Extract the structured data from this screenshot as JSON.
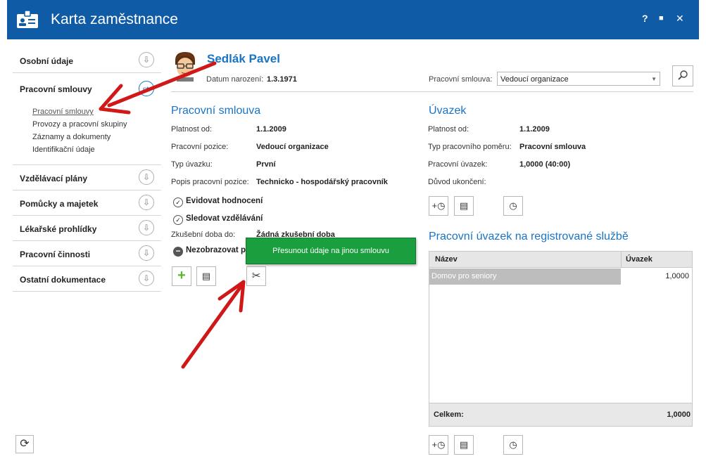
{
  "window": {
    "title": "Karta zaměstnance",
    "controls": {
      "help": "?",
      "maximize": "■",
      "close": "✕"
    }
  },
  "sidebar": {
    "items": [
      {
        "label": "Osobní údaje"
      },
      {
        "label": "Pracovní smlouvy"
      },
      {
        "label": "Vzdělávací plány"
      },
      {
        "label": "Pomůcky a majetek"
      },
      {
        "label": "Lékařské prohlídky"
      },
      {
        "label": "Pracovní činnosti"
      },
      {
        "label": "Ostatní dokumentace"
      }
    ],
    "subitems": [
      "Pracovní smlouvy",
      "Provozy a pracovní skupiny",
      "Záznamy a dokumenty",
      "Identifikační údaje"
    ]
  },
  "employee": {
    "name": "Sedlák Pavel",
    "dob_label": "Datum narození:",
    "dob_value": "1.3.1971",
    "contract_label": "Pracovní smlouva:",
    "contract_value": "Vedoucí organizace"
  },
  "contract": {
    "title": "Pracovní smlouva",
    "valid_from_label": "Platnost od:",
    "valid_from": "1.1.2009",
    "position_label": "Pracovní pozice:",
    "position": "Vedoucí organizace",
    "type_label": "Typ úvazku:",
    "type": "První",
    "desc_label": "Popis pracovní pozice:",
    "desc": "Technicko - hospodářský pracovník",
    "check1": "Evidovat hodnocení",
    "check2": "Sledovat vzdělávání",
    "probation_label": "Zkušební doba do:",
    "probation": "Žádná zkušební doba",
    "hide_label": "Nezobrazovat p"
  },
  "tooltip": {
    "text": "Přesunout údaje na jinou smlouvu"
  },
  "workload": {
    "title": "Úvazek",
    "valid_from_label": "Platnost od:",
    "valid_from": "1.1.2009",
    "type_label": "Typ pracovního poměru:",
    "type": "Pracovní smlouva",
    "ratio_label": "Pracovní úvazek:",
    "ratio": "1,0000 (40:00)",
    "end_label": "Důvod ukončení:"
  },
  "service": {
    "title": "Pracovní úvazek na registrované službě",
    "col_name": "Název",
    "col_ratio": "Úvazek",
    "rows": [
      {
        "name": "Domov pro seniory",
        "ratio": "1,0000"
      }
    ],
    "total_label": "Celkem:",
    "total": "1,0000"
  },
  "icons": {
    "sidebar_circle": "arrow-down-circle-icon",
    "sidebar_active": "arrow-right-circle-icon"
  },
  "colors": {
    "titlebar": "#0f5ba6",
    "accent": "#1a74c4",
    "tooltip": "#1a9e3e",
    "arrow": "#d01818",
    "plus": "#5cb531"
  }
}
